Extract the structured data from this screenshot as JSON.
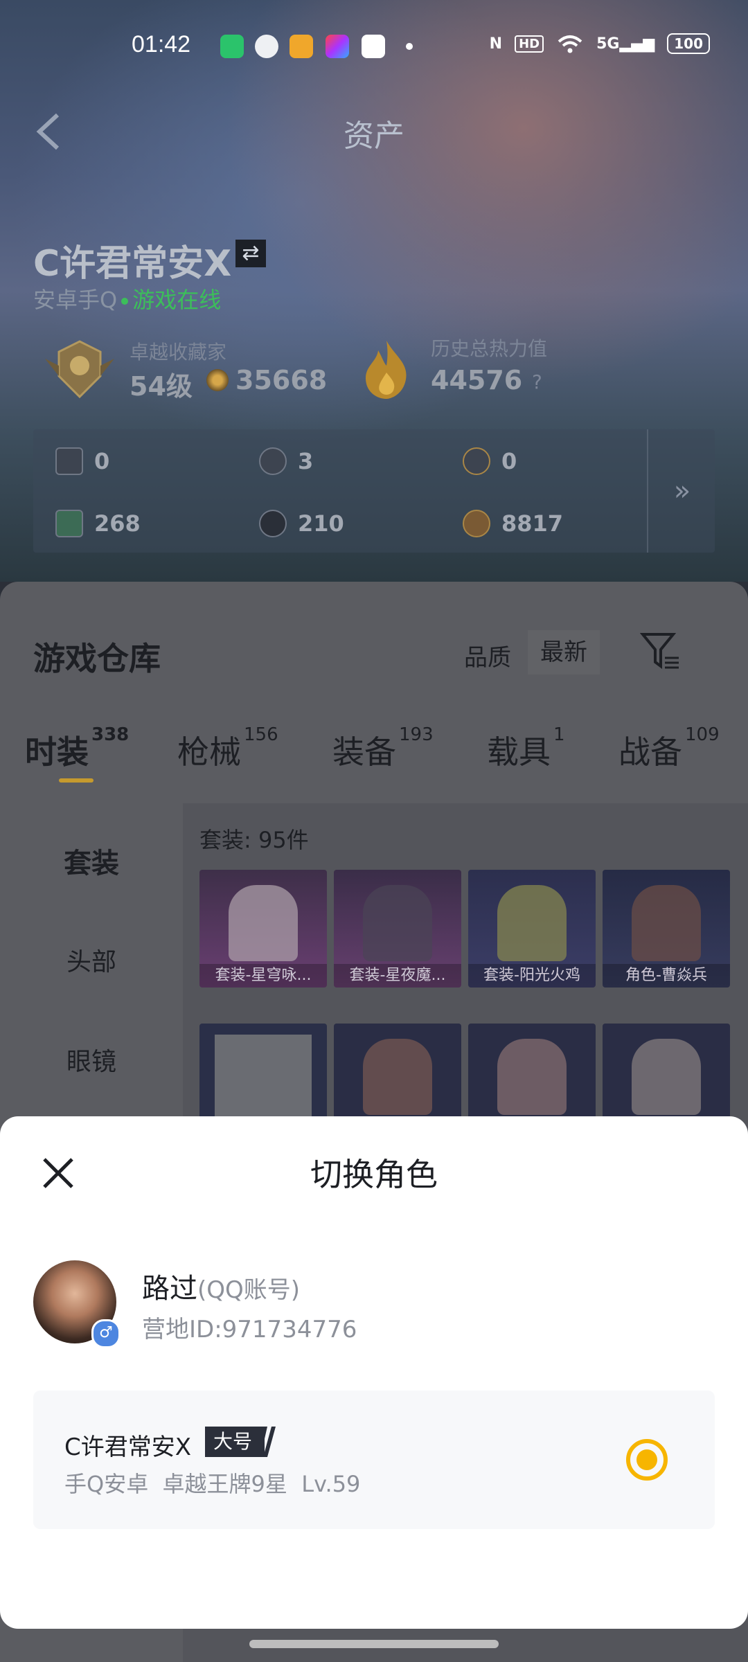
{
  "status_bar": {
    "time": "01:42",
    "battery": "100",
    "network": "5G"
  },
  "header": {
    "title": "资产"
  },
  "profile": {
    "name": "C许君常安X",
    "platform": "安卓手Q",
    "status": "游戏在线",
    "rank_title": "卓越收藏家",
    "rank_level": "54级",
    "coins": "35668",
    "heat_title": "历史总热力值",
    "heat_value": "44576",
    "heat_help": "?"
  },
  "resources": [
    {
      "icon": "card-icon",
      "value": "0"
    },
    {
      "icon": "token-icon",
      "value": "3"
    },
    {
      "icon": "medal-icon",
      "value": "0"
    },
    {
      "icon": "ticket-icon",
      "value": "268"
    },
    {
      "icon": "orb-icon",
      "value": "210"
    },
    {
      "icon": "coin-icon",
      "value": "8817"
    }
  ],
  "warehouse": {
    "title": "游戏仓库",
    "sort_quality": "品质",
    "sort_latest": "最新",
    "tabs": [
      {
        "label": "时装",
        "count": "338"
      },
      {
        "label": "枪械",
        "count": "156"
      },
      {
        "label": "装备",
        "count": "193"
      },
      {
        "label": "载具",
        "count": "1"
      },
      {
        "label": "战备",
        "count": "109"
      }
    ],
    "side_items": [
      "套装",
      "头部",
      "眼镜"
    ],
    "count_label": "套装: 95件",
    "cards": [
      {
        "label": "套装-星穹咏..."
      },
      {
        "label": "套装-星夜魔..."
      },
      {
        "label": "套装-阳光火鸡"
      },
      {
        "label": "角色-曹焱兵"
      }
    ]
  },
  "modal": {
    "title": "切换角色",
    "account_name": "路过",
    "account_type": "(QQ账号)",
    "camp_id": "营地ID:971734776",
    "gender": "♂",
    "role": {
      "name": "C许君常安X",
      "tag": "大号",
      "info": "手Q安卓  卓越王牌9星  Lv.59"
    }
  },
  "colors": {
    "accent": "#f7b500",
    "online": "#3cbf5a",
    "tab_underline": "#c59a2e"
  }
}
